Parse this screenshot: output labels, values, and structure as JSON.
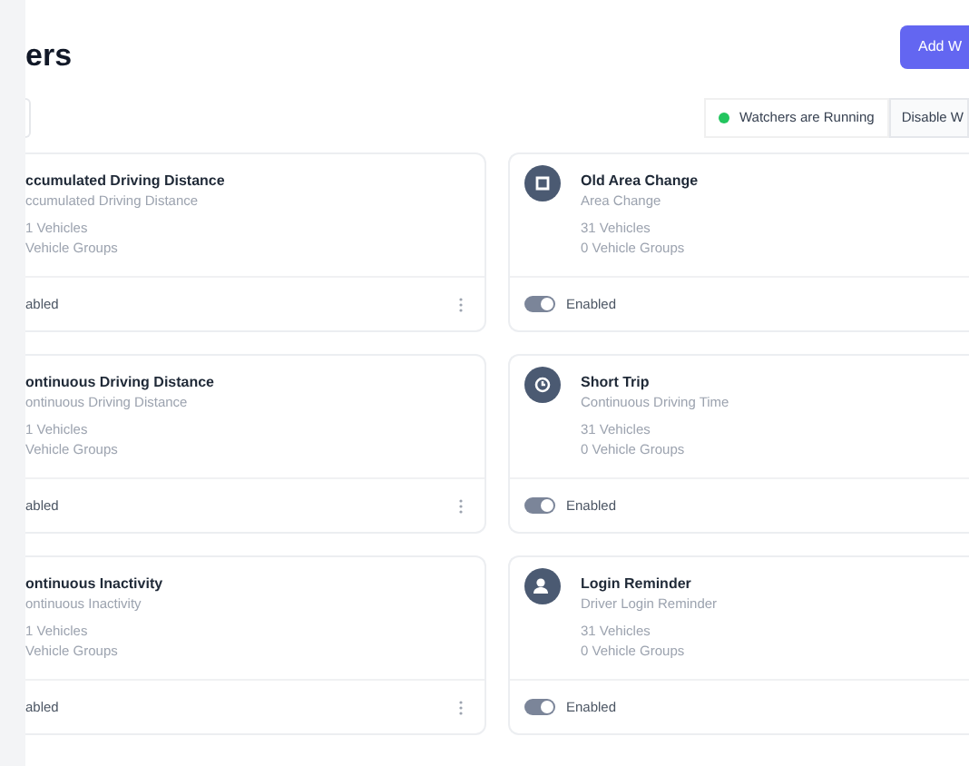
{
  "header": {
    "title": "ers",
    "add_button": "Add W"
  },
  "status": {
    "label": "Watchers are Running",
    "color": "#22c55e",
    "disable_button": "Disable W"
  },
  "left_column": [
    {
      "title": "ccumulated Driving Distance",
      "type": "ccumulated Driving Distance",
      "vehicles": "1 Vehicles",
      "groups": "Vehicle Groups",
      "status": "abled"
    },
    {
      "title": "ontinuous Driving Distance",
      "type": "ontinuous Driving Distance",
      "vehicles": "1 Vehicles",
      "groups": "Vehicle Groups",
      "status": "abled"
    },
    {
      "title": "ontinuous Inactivity",
      "type": "ontinuous Inactivity",
      "vehicles": "1 Vehicles",
      "groups": "Vehicle Groups",
      "status": "abled"
    }
  ],
  "right_column": [
    {
      "kind": "area",
      "title": "Old Area Change",
      "type": "Area Change",
      "vehicles": "31 Vehicles",
      "groups": "0 Vehicle Groups",
      "status": "Enabled",
      "enabled": true
    },
    {
      "kind": "trip",
      "title": "Short Trip",
      "type": "Continuous Driving Time",
      "vehicles": "31 Vehicles",
      "groups": "0 Vehicle Groups",
      "status": "Enabled",
      "enabled": true
    },
    {
      "kind": "driver",
      "title": "Login Reminder",
      "type": "Driver Login Reminder",
      "vehicles": "31 Vehicles",
      "groups": "0 Vehicle Groups",
      "status": "Enabled",
      "enabled": true
    }
  ]
}
